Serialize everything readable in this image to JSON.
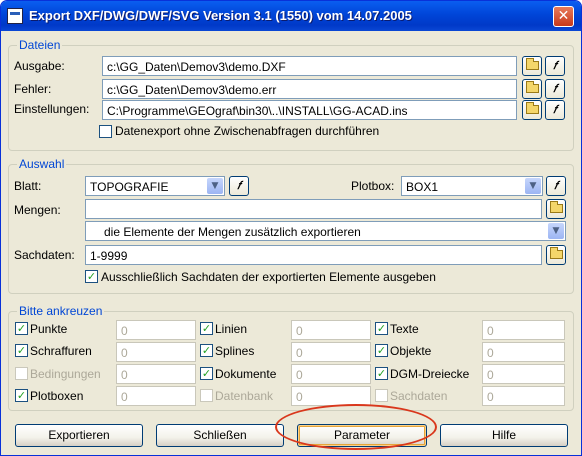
{
  "window": {
    "title": "Export DXF/DWG/DWF/SVG Version 3.1 (1550) vom 14.07.2005",
    "close_glyph": "✕",
    "icon": "app-window-icon"
  },
  "dateien": {
    "title": "Dateien",
    "ausgabe_label": "Ausgabe:",
    "ausgabe_value": "c:\\GG_Daten\\Demov3\\demo.DXF",
    "fehler_label": "Fehler:",
    "fehler_value": "c:\\GG_Daten\\Demov3\\demo.err",
    "einstellungen_label": "Einstellungen:",
    "einstellungen_value": "C:\\Programme\\GEOgraf\\bin30\\..\\INSTALL\\GG-ACAD.ins",
    "ohne_zwischen_label": "Datenexport ohne Zwischenabfragen durchführen",
    "ohne_zwischen_checked": false
  },
  "auswahl": {
    "title": "Auswahl",
    "blatt_label": "Blatt:",
    "blatt_value": "TOPOGRAFIE",
    "plotbox_label": "Plotbox:",
    "plotbox_value": "BOX1",
    "mengen_label": "Mengen:",
    "mengen_value": "",
    "mengen_mode": "die Elemente der Mengen zusätzlich exportieren",
    "sachdaten_label": "Sachdaten:",
    "sachdaten_value": "1-9999",
    "sachdaten_only_label": "Ausschließlich Sachdaten der exportierten Elemente ausgeben",
    "sachdaten_only_checked": true
  },
  "ankreuzen": {
    "title": "Bitte ankreuzen",
    "col1": [
      {
        "label": "Punkte",
        "checked": true,
        "enabled": true,
        "value": "0"
      },
      {
        "label": "Schraffuren",
        "checked": true,
        "enabled": true,
        "value": "0"
      },
      {
        "label": "Bedingungen",
        "checked": false,
        "enabled": false,
        "value": "0"
      },
      {
        "label": "Plotboxen",
        "checked": true,
        "enabled": true,
        "value": "0"
      }
    ],
    "col2": [
      {
        "label": "Linien",
        "checked": true,
        "enabled": true,
        "value": "0"
      },
      {
        "label": "Splines",
        "checked": true,
        "enabled": true,
        "value": "0"
      },
      {
        "label": "Dokumente",
        "checked": true,
        "enabled": true,
        "value": "0"
      },
      {
        "label": "Datenbank",
        "checked": false,
        "enabled": false,
        "value": "0"
      }
    ],
    "col3": [
      {
        "label": "Texte",
        "checked": true,
        "enabled": true,
        "value": "0"
      },
      {
        "label": "Objekte",
        "checked": true,
        "enabled": true,
        "value": "0"
      },
      {
        "label": "DGM-Dreiecke",
        "checked": true,
        "enabled": true,
        "value": "0"
      },
      {
        "label": "Sachdaten",
        "checked": false,
        "enabled": false,
        "value": "0"
      }
    ],
    "check_glyph": "✓"
  },
  "buttons": {
    "exportieren": "Exportieren",
    "schliessen": "Schließen",
    "parameter": "Parameter",
    "hilfe": "Hilfe"
  },
  "icons": {
    "browse": "folder-open-icon",
    "edit": "pencil-edit-icon",
    "pen_glyph": "𝑓",
    "dropdown_glyph": "▼"
  },
  "colors": {
    "titlebar": "#0045d8",
    "group_title": "#0046d5",
    "highlight": "#d9371c"
  }
}
